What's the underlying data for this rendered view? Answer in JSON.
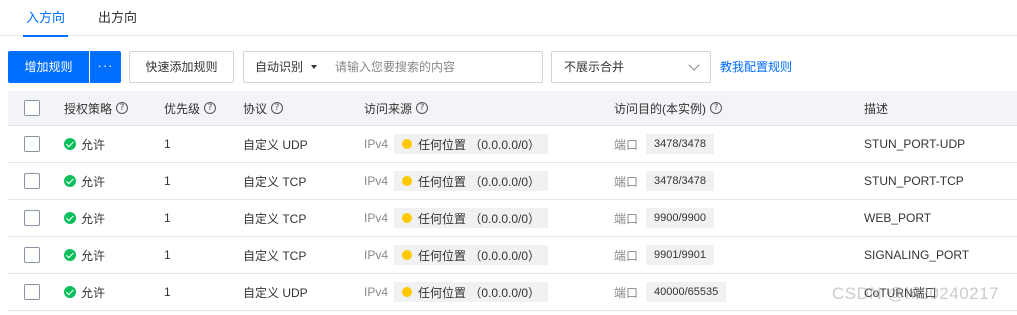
{
  "tabs": [
    {
      "label": "入方向",
      "active": true
    },
    {
      "label": "出方向",
      "active": false
    }
  ],
  "toolbar": {
    "add_rule_label": "增加规则",
    "more_label": "···",
    "quick_add_label": "快速添加规则",
    "search_type_label": "自动识别",
    "search_placeholder": "请输入您要搜索的内容",
    "merge_select_value": "不展示合并",
    "help_link_label": "教我配置规则"
  },
  "table": {
    "headers": {
      "policy": "授权策略",
      "priority": "优先级",
      "protocol": "协议",
      "source": "访问来源",
      "destination": "访问目的(本实例)",
      "description": "描述"
    },
    "rows": [
      {
        "policy": "允许",
        "priority": "1",
        "protocol": "自定义 UDP",
        "ip_version": "IPv4",
        "source": "任何位置 （0.0.0.0/0）",
        "port_label": "端口",
        "port": "3478/3478",
        "description": "STUN_PORT-UDP"
      },
      {
        "policy": "允许",
        "priority": "1",
        "protocol": "自定义 TCP",
        "ip_version": "IPv4",
        "source": "任何位置 （0.0.0.0/0）",
        "port_label": "端口",
        "port": "3478/3478",
        "description": "STUN_PORT-TCP"
      },
      {
        "policy": "允许",
        "priority": "1",
        "protocol": "自定义 TCP",
        "ip_version": "IPv4",
        "source": "任何位置 （0.0.0.0/0）",
        "port_label": "端口",
        "port": "9900/9900",
        "description": "WEB_PORT"
      },
      {
        "policy": "允许",
        "priority": "1",
        "protocol": "自定义 TCP",
        "ip_version": "IPv4",
        "source": "任何位置 （0.0.0.0/0）",
        "port_label": "端口",
        "port": "9901/9901",
        "description": "SIGNALING_PORT"
      },
      {
        "policy": "允许",
        "priority": "1",
        "protocol": "自定义 UDP",
        "ip_version": "IPv4",
        "source": "任何位置 （0.0.0.0/0）",
        "port_label": "端口",
        "port": "40000/65535",
        "description": "CoTURN端口"
      }
    ]
  },
  "watermark": "CSDN @hi20240217",
  "colors": {
    "accent": "#006eff",
    "allow_green": "#0abf5b",
    "location_dot": "#ffc800",
    "header_bg": "#f3f4f7"
  }
}
